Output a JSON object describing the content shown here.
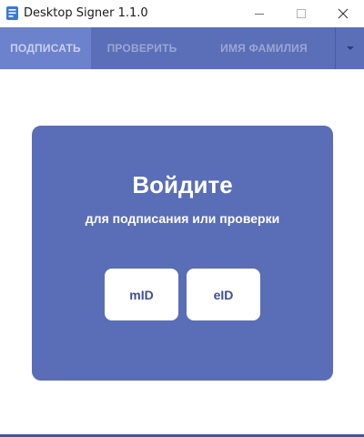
{
  "window": {
    "title": "Desktop Signer 1.1.0"
  },
  "nav": {
    "tabs": [
      {
        "label": "ПОДПИСАТЬ",
        "active": true
      },
      {
        "label": "ПРОВЕРИТЬ",
        "active": false
      },
      {
        "label": "ИМЯ ФАМИЛИЯ",
        "active": false
      }
    ],
    "dropdown_icon": "chevron-down-icon"
  },
  "card": {
    "title": "Войдите",
    "subtitle": "для подписания или проверки",
    "buttons": [
      {
        "label": "mID"
      },
      {
        "label": "eID"
      }
    ]
  },
  "colors": {
    "nav_bg": "#5b6fb8",
    "nav_active_bg": "#6d82cc",
    "card_bg": "#5a6db7",
    "button_text": "#3d4f96",
    "accent_bottom": "#3f56a8"
  }
}
